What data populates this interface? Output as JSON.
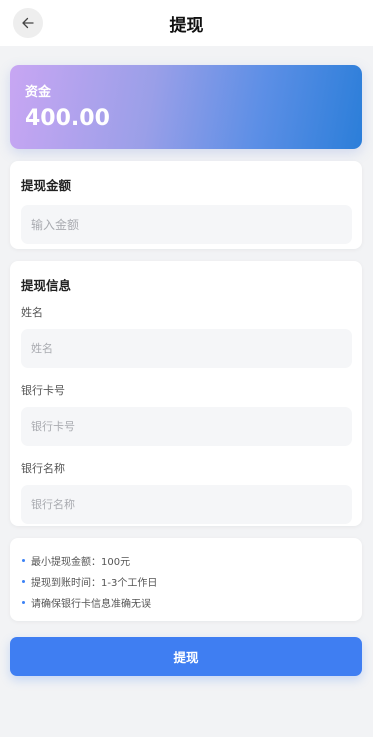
{
  "header": {
    "title": "提现",
    "back_icon": "arrow-left-icon"
  },
  "balance": {
    "label": "资金",
    "value": "400.00"
  },
  "amount_section": {
    "title": "提现金额",
    "placeholder": "输入金额",
    "value": ""
  },
  "info_section": {
    "title": "提现信息",
    "name_label": "姓名",
    "name_placeholder": "姓名",
    "card_label": "银行卡号",
    "card_placeholder": "银行卡号",
    "bank_label": "银行名称",
    "bank_placeholder": "银行名称"
  },
  "tips": [
    "最小提现金额：100元",
    "提现到账时间：1-3个工作日",
    "请确保银行卡信息准确无误"
  ],
  "submit_label": "提现",
  "colors": {
    "primary": "#3f7ef2",
    "bullet": "#3b82f6",
    "background": "#f2f3f5"
  }
}
